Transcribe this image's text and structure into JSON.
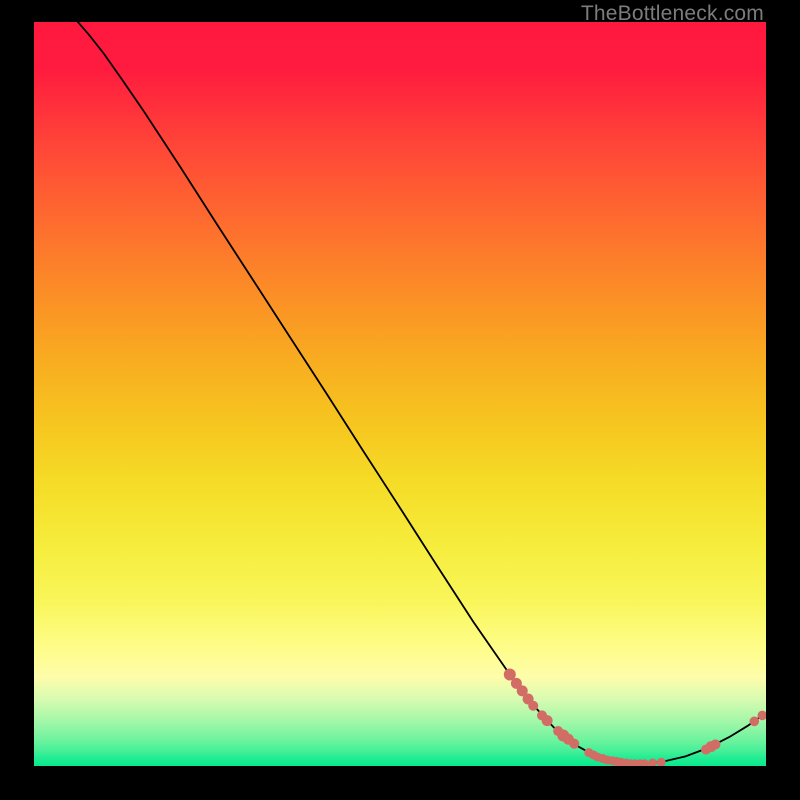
{
  "watermark": "TheBottleneck.com",
  "chart_data": {
    "type": "line",
    "title": "",
    "xlabel": "",
    "ylabel": "",
    "xlim": [
      0,
      100
    ],
    "ylim": [
      0,
      100
    ],
    "curve": {
      "name": "bottleneck-curve",
      "color": "#000000",
      "stroke_width": 1.8,
      "points": [
        {
          "x": 6.0,
          "y": 100.0
        },
        {
          "x": 7.5,
          "y": 98.3
        },
        {
          "x": 9.5,
          "y": 95.8
        },
        {
          "x": 12.0,
          "y": 92.3
        },
        {
          "x": 15.0,
          "y": 88.0
        },
        {
          "x": 20.0,
          "y": 80.5
        },
        {
          "x": 25.0,
          "y": 72.8
        },
        {
          "x": 30.0,
          "y": 65.2
        },
        {
          "x": 35.0,
          "y": 57.6
        },
        {
          "x": 40.0,
          "y": 50.0
        },
        {
          "x": 45.0,
          "y": 42.3
        },
        {
          "x": 50.0,
          "y": 34.7
        },
        {
          "x": 55.0,
          "y": 27.0
        },
        {
          "x": 60.0,
          "y": 19.4
        },
        {
          "x": 65.0,
          "y": 12.3
        },
        {
          "x": 68.0,
          "y": 8.4
        },
        {
          "x": 71.0,
          "y": 5.2
        },
        {
          "x": 74.0,
          "y": 2.8
        },
        {
          "x": 77.0,
          "y": 1.2
        },
        {
          "x": 80.0,
          "y": 0.5
        },
        {
          "x": 83.0,
          "y": 0.3
        },
        {
          "x": 86.0,
          "y": 0.6
        },
        {
          "x": 89.0,
          "y": 1.3
        },
        {
          "x": 92.0,
          "y": 2.4
        },
        {
          "x": 95.0,
          "y": 3.9
        },
        {
          "x": 97.5,
          "y": 5.4
        },
        {
          "x": 99.5,
          "y": 6.8
        }
      ]
    },
    "scatter": {
      "name": "highlighted-points",
      "color": "#d16d65",
      "radius_default": 5.5,
      "points": [
        {
          "x": 65.0,
          "y": 12.3,
          "r": 6.0
        },
        {
          "x": 65.9,
          "y": 11.1,
          "r": 5.5
        },
        {
          "x": 66.7,
          "y": 10.1,
          "r": 5.5
        },
        {
          "x": 67.5,
          "y": 9.0,
          "r": 5.5
        },
        {
          "x": 68.2,
          "y": 8.1,
          "r": 5.0
        },
        {
          "x": 69.4,
          "y": 6.8,
          "r": 5.0
        },
        {
          "x": 70.1,
          "y": 6.1,
          "r": 5.5
        },
        {
          "x": 71.6,
          "y": 4.7,
          "r": 5.0
        },
        {
          "x": 72.3,
          "y": 4.1,
          "r": 6.0
        },
        {
          "x": 73.0,
          "y": 3.6,
          "r": 5.5
        },
        {
          "x": 73.8,
          "y": 3.0,
          "r": 5.0
        },
        {
          "x": 75.8,
          "y": 1.8,
          "r": 4.5
        },
        {
          "x": 76.4,
          "y": 1.5,
          "r": 4.5
        },
        {
          "x": 77.0,
          "y": 1.2,
          "r": 4.5
        },
        {
          "x": 77.7,
          "y": 1.0,
          "r": 4.5
        },
        {
          "x": 78.3,
          "y": 0.8,
          "r": 4.5
        },
        {
          "x": 79.0,
          "y": 0.7,
          "r": 4.5
        },
        {
          "x": 79.6,
          "y": 0.6,
          "r": 4.5
        },
        {
          "x": 80.2,
          "y": 0.5,
          "r": 4.5
        },
        {
          "x": 80.9,
          "y": 0.4,
          "r": 4.5
        },
        {
          "x": 81.5,
          "y": 0.3,
          "r": 4.5
        },
        {
          "x": 82.1,
          "y": 0.3,
          "r": 4.5
        },
        {
          "x": 82.8,
          "y": 0.3,
          "r": 4.5
        },
        {
          "x": 83.4,
          "y": 0.3,
          "r": 4.5
        },
        {
          "x": 84.5,
          "y": 0.4,
          "r": 4.5
        },
        {
          "x": 85.7,
          "y": 0.5,
          "r": 4.5
        },
        {
          "x": 91.8,
          "y": 2.2,
          "r": 5.0
        },
        {
          "x": 92.5,
          "y": 2.6,
          "r": 5.5
        },
        {
          "x": 93.1,
          "y": 2.9,
          "r": 5.0
        },
        {
          "x": 98.4,
          "y": 6.0,
          "r": 4.8
        },
        {
          "x": 99.5,
          "y": 6.8,
          "r": 4.8
        }
      ]
    }
  }
}
